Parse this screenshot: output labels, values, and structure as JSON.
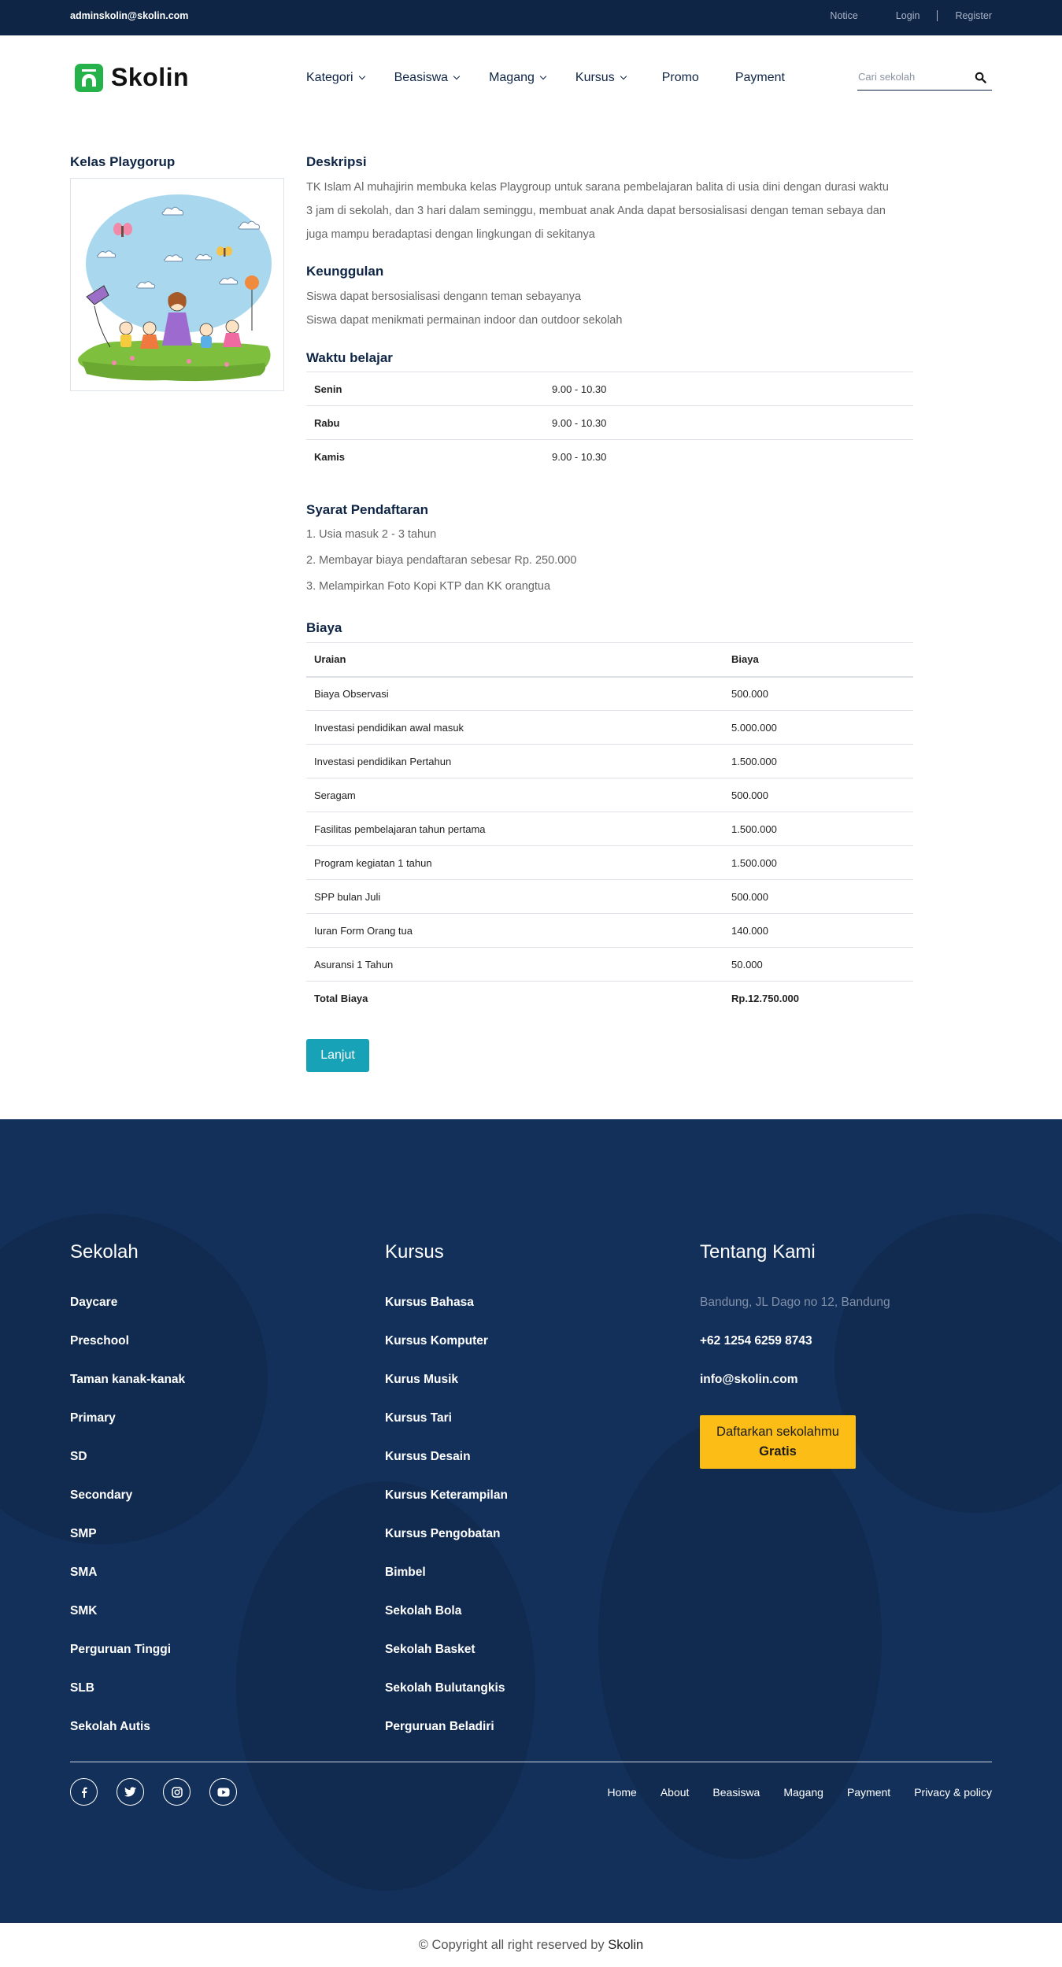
{
  "topbar": {
    "email": "adminskolin@skolin.com",
    "notice": "Notice",
    "login": "Login",
    "register": "Register"
  },
  "header": {
    "logo_text": "Skolin",
    "nav": [
      {
        "label": "Kategori",
        "dropdown": true
      },
      {
        "label": "Beasiswa",
        "dropdown": true
      },
      {
        "label": "Magang",
        "dropdown": true
      },
      {
        "label": "Kursus",
        "dropdown": true
      },
      {
        "label": "Promo",
        "dropdown": false
      },
      {
        "label": "Payment",
        "dropdown": false
      }
    ],
    "search_placeholder": "Cari sekolah",
    "search_icon": "search-icon"
  },
  "left": {
    "title": "Kelas Playgorup"
  },
  "deskripsi": {
    "title": "Deskripsi",
    "text": "TK Islam Al muhajirin membuka kelas Playgroup untuk sarana pembelajaran balita di usia dini dengan durasi waktu 3 jam di sekolah, dan 3 hari dalam seminggu, membuat anak Anda dapat bersosialisasi dengan teman sebaya dan juga mampu beradaptasi dengan lingkungan di sekitanya"
  },
  "keunggulan": {
    "title": "Keunggulan",
    "items": [
      "Siswa dapat bersosialisasi dengann teman sebayanya",
      "Siswa dapat menikmati permainan indoor dan outdoor sekolah"
    ]
  },
  "waktu": {
    "title": "Waktu belajar",
    "rows": [
      {
        "day": "Senin",
        "time": "9.00 - 10.30"
      },
      {
        "day": "Rabu",
        "time": "9.00 - 10.30"
      },
      {
        "day": "Kamis",
        "time": "9.00 - 10.30"
      }
    ]
  },
  "syarat": {
    "title": "Syarat Pendaftaran",
    "items": [
      "1. Usia masuk 2 - 3 tahun",
      "2. Membayar biaya pendaftaran sebesar Rp. 250.000",
      "3. Melampirkan Foto Kopi KTP dan KK orangtua"
    ]
  },
  "biaya": {
    "title": "Biaya",
    "headers": [
      "Uraian",
      "Biaya"
    ],
    "rows": [
      {
        "uraian": "Biaya Observasi",
        "biaya": "500.000"
      },
      {
        "uraian": "Investasi pendidikan awal masuk",
        "biaya": "5.000.000"
      },
      {
        "uraian": "Investasi pendidikan Pertahun",
        "biaya": "1.500.000"
      },
      {
        "uraian": "Seragam",
        "biaya": "500.000"
      },
      {
        "uraian": "Fasilitas pembelajaran tahun pertama",
        "biaya": "1.500.000"
      },
      {
        "uraian": "Program kegiatan 1 tahun",
        "biaya": "1.500.000"
      },
      {
        "uraian": "SPP bulan Juli",
        "biaya": "500.000"
      },
      {
        "uraian": "Iuran Form Orang tua",
        "biaya": "140.000"
      },
      {
        "uraian": "Asuransi 1 Tahun",
        "biaya": "50.000"
      }
    ],
    "total_label": "Total Biaya",
    "total_value": "Rp.12.750.000"
  },
  "button_lanjut": "Lanjut",
  "footer": {
    "sekolah": {
      "title": "Sekolah",
      "items": [
        "Daycare",
        "Preschool",
        "Taman kanak-kanak",
        "Primary",
        "SD",
        "Secondary",
        "SMP",
        "SMA",
        "SMK",
        "Perguruan Tinggi",
        "SLB",
        "Sekolah Autis"
      ]
    },
    "kursus": {
      "title": "Kursus",
      "items": [
        "Kursus Bahasa",
        "Kursus Komputer",
        "Kurus Musik",
        "Kursus Tari",
        "Kursus Desain",
        "Kursus Keterampilan",
        "Kursus Pengobatan",
        "Bimbel",
        "Sekolah Bola",
        "Sekolah Basket",
        "Sekolah Bulutangkis",
        "Perguruan Beladiri"
      ]
    },
    "tentang": {
      "title": "Tentang Kami",
      "address": "Bandung, JL Dago no 12, Bandung",
      "phone": "+62 1254 6259 8743",
      "email": "info@skolin.com",
      "cta_line1": "Daftarkan sekolahmu",
      "cta_line2": "Gratis"
    },
    "social": [
      "facebook-icon",
      "twitter-icon",
      "instagram-icon",
      "youtube-icon"
    ],
    "nav": [
      "Home",
      "About",
      "Beasiswa",
      "Magang",
      "Payment",
      "Privacy & policy"
    ],
    "bg_color": "#13305a"
  },
  "copyright": {
    "text": "© Copyright all right reserved by",
    "brand": "Skolin"
  },
  "colors": {
    "navy": "#0f2545",
    "teal_button": "#17a2b8",
    "cta_yellow": "#fcbd17",
    "logo_green": "#25b24a"
  }
}
